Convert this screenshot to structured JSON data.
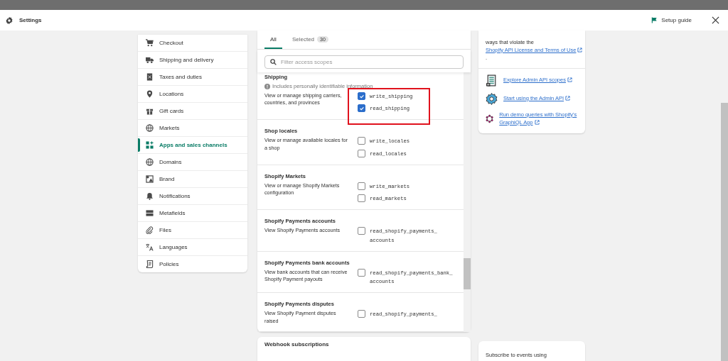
{
  "header": {
    "title": "Settings",
    "setup_guide": "Setup guide"
  },
  "sidebar": {
    "items": [
      {
        "label": "Checkout",
        "selected": false
      },
      {
        "label": "Shipping and delivery",
        "selected": false
      },
      {
        "label": "Taxes and duties",
        "selected": false
      },
      {
        "label": "Locations",
        "selected": false
      },
      {
        "label": "Gift cards",
        "selected": false
      },
      {
        "label": "Markets",
        "selected": false
      },
      {
        "label": "Apps and sales channels",
        "selected": true
      },
      {
        "label": "Domains",
        "selected": false
      },
      {
        "label": "Brand",
        "selected": false
      },
      {
        "label": "Notifications",
        "selected": false
      },
      {
        "label": "Metafields",
        "selected": false
      },
      {
        "label": "Files",
        "selected": false
      },
      {
        "label": "Languages",
        "selected": false
      },
      {
        "label": "Policies",
        "selected": false
      }
    ]
  },
  "scopes_panel": {
    "tabs": [
      {
        "label": "All",
        "selected": true
      },
      {
        "label": "Selected",
        "count": "30",
        "selected": false
      }
    ],
    "search": {
      "placeholder": "Filter access scopes"
    },
    "sections": [
      {
        "title": "Shipping",
        "note": "Includes personally identifiable information",
        "description": "View or manage shipping carriers, countries, and provinces",
        "highlighted": true,
        "scopes": [
          {
            "name": "write_shipping",
            "checked": true
          },
          {
            "name": "read_shipping",
            "checked": true
          }
        ]
      },
      {
        "title": "Shop locales",
        "description": "View or manage available locales for a shop",
        "scopes": [
          {
            "name": "write_locales",
            "checked": false
          },
          {
            "name": "read_locales",
            "checked": false
          }
        ]
      },
      {
        "title": "Shopify Markets",
        "description": "View or manage Shopify Markets configuration",
        "scopes": [
          {
            "name": "write_markets",
            "checked": false
          },
          {
            "name": "read_markets",
            "checked": false
          }
        ]
      },
      {
        "title": "Shopify Payments accounts",
        "description": "View Shopify Payments accounts",
        "scopes": [
          {
            "name": "read_shopify_payments_accounts",
            "checked": false
          }
        ]
      },
      {
        "title": "Shopify Payments bank accounts",
        "description": "View bank accounts that can receive Shopify Payment payouts",
        "scopes": [
          {
            "name": "read_shopify_payments_bank_accounts",
            "checked": false
          }
        ]
      },
      {
        "title": "Shopify Payments disputes",
        "description": "View Shopify Payment disputes raised",
        "scopes": [
          {
            "name": "read_shopify_payments_",
            "checked": false
          }
        ]
      }
    ]
  },
  "webhook_card": {
    "title": "Webhook subscriptions"
  },
  "info_card": {
    "text_before": "ways that violate the",
    "link": "Shopify API License and Terms of Use",
    "text_after": ".",
    "links": [
      "Explore Admin API scopes",
      "Start using the Admin API",
      "Run demo queries with Shopify's GraphiQL App"
    ]
  },
  "subscribe_card": {
    "text": "Subscribe to events using"
  }
}
